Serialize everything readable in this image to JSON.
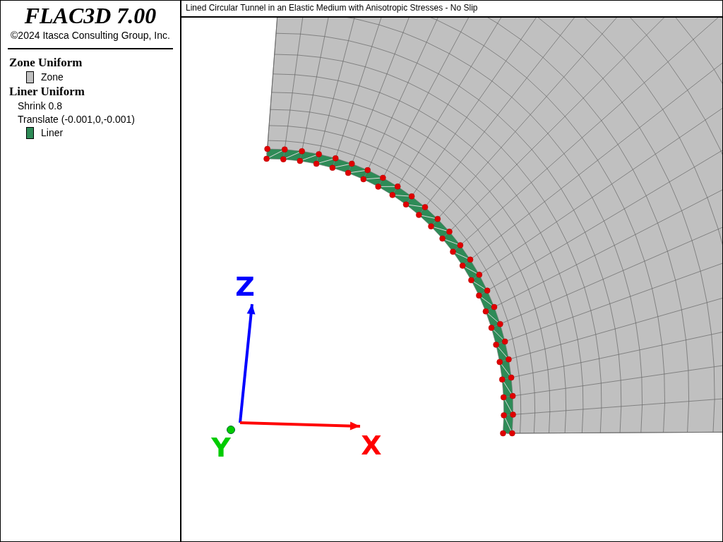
{
  "legend": {
    "product": "FLAC3D 7.00",
    "copyright": "©2024 Itasca Consulting Group, Inc.",
    "groups": [
      {
        "title": "Zone Uniform",
        "entries": [
          {
            "kind": "swatch",
            "label": "Zone",
            "color": "#c0c0c0"
          }
        ]
      },
      {
        "title": "Liner Uniform",
        "entries": [
          {
            "kind": "text",
            "label": "Shrink 0.8"
          },
          {
            "kind": "text",
            "label": "Translate (-0.001,0,-0.001)"
          },
          {
            "kind": "swatch",
            "label": "Liner",
            "color": "#2e8b57"
          }
        ]
      }
    ]
  },
  "plot": {
    "title": "Lined Circular Tunnel in an Elastic Medium with Anisotropic Stresses - No Slip",
    "axes": [
      {
        "label": "Z",
        "kind": "arrow",
        "color": "#0000ff"
      },
      {
        "label": "Y",
        "kind": "point",
        "color": "#00cc00"
      },
      {
        "label": "X",
        "kind": "arrow",
        "color": "#ff0000"
      }
    ]
  }
}
